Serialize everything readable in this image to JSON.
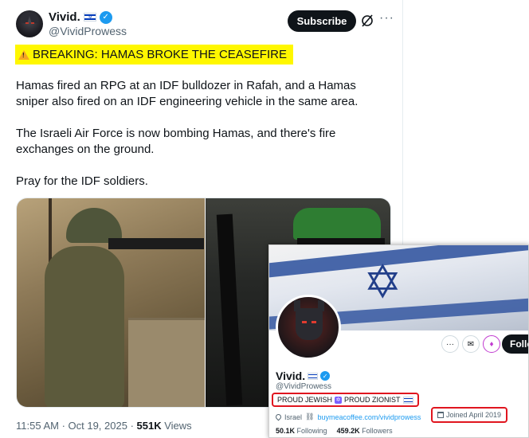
{
  "post": {
    "display_name": "Vivid.",
    "handle": "@VividProwess",
    "subscribe_label": "Subscribe",
    "more_label": "···",
    "breaking": "BREAKING: HAMAS BROKE THE CEASEFIRE",
    "paragraphs": [
      "Hamas fired an RPG at an IDF bulldozer in Rafah, and a Hamas sniper also fired on an IDF engineering vehicle in the same area.",
      "The Israeli Air Force is now bombing Hamas, and there's fire exchanges on the ground.",
      "Pray for the IDF soldiers."
    ],
    "timestamp": "11:55 AM · Oct 19, 2025 · ",
    "views_count": "551K",
    "views_label": " Views"
  },
  "profile": {
    "name": "Vivid.",
    "handle": "@VividProwess",
    "follow_label": "Follo",
    "bio_part1": "PROUD JEWISH",
    "bio_part2": "PROUD ZIONIST",
    "location": "Israel",
    "website": "buymeacoffee.com/vividprowess",
    "joined": "Joined April 2019",
    "following_count": "50.1K",
    "following_label": "Following",
    "followers_count": "459.2K",
    "followers_label": "Followers"
  },
  "colors": {
    "highlight": "#fff700",
    "verified": "#1d9bf0",
    "annotation_box": "#e0161f"
  }
}
